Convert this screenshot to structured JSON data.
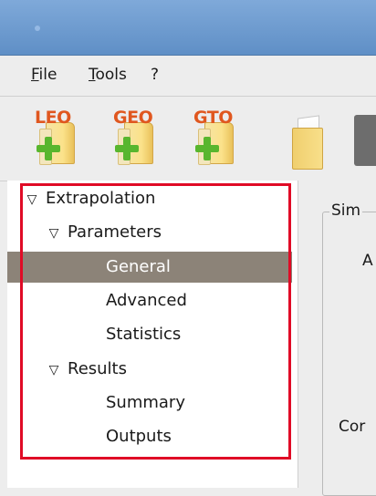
{
  "menubar": {
    "items": [
      {
        "label": "File",
        "underline": "F",
        "rest": "ile"
      },
      {
        "label": "Tools",
        "underline": "T",
        "rest": "ools"
      },
      {
        "label": "?",
        "underline": "",
        "rest": "?"
      }
    ]
  },
  "toolbar": {
    "buttons": [
      {
        "label": "LEO",
        "icon": "new-leo-icon"
      },
      {
        "label": "GEO",
        "icon": "new-geo-icon"
      },
      {
        "label": "GTO",
        "icon": "new-gto-icon"
      }
    ],
    "open_icon": "open-folder-icon",
    "save_icon": "save-disk-icon"
  },
  "tree": {
    "items": [
      {
        "label": "Extrapolation",
        "level": 0,
        "expandable": true,
        "expanded": true,
        "selected": false
      },
      {
        "label": "Parameters",
        "level": 1,
        "expandable": true,
        "expanded": true,
        "selected": false
      },
      {
        "label": "General",
        "level": 2,
        "expandable": false,
        "selected": true
      },
      {
        "label": "Advanced",
        "level": 2,
        "expandable": false,
        "selected": false
      },
      {
        "label": "Statistics",
        "level": 2,
        "expandable": false,
        "selected": false
      },
      {
        "label": "Results",
        "level": 1,
        "expandable": true,
        "expanded": true,
        "selected": false
      },
      {
        "label": "Summary",
        "level": 2,
        "expandable": false,
        "selected": false
      },
      {
        "label": "Outputs",
        "level": 2,
        "expandable": false,
        "selected": false
      }
    ],
    "selection_color": "#8c8378"
  },
  "annotation": {
    "highlight_color": "#e00b26"
  },
  "right_panel": {
    "group_title": "Sim",
    "label_a": "A",
    "label_con": "Cor"
  },
  "colors": {
    "titlebar": "#6f9dd0",
    "background": "#ededed"
  }
}
